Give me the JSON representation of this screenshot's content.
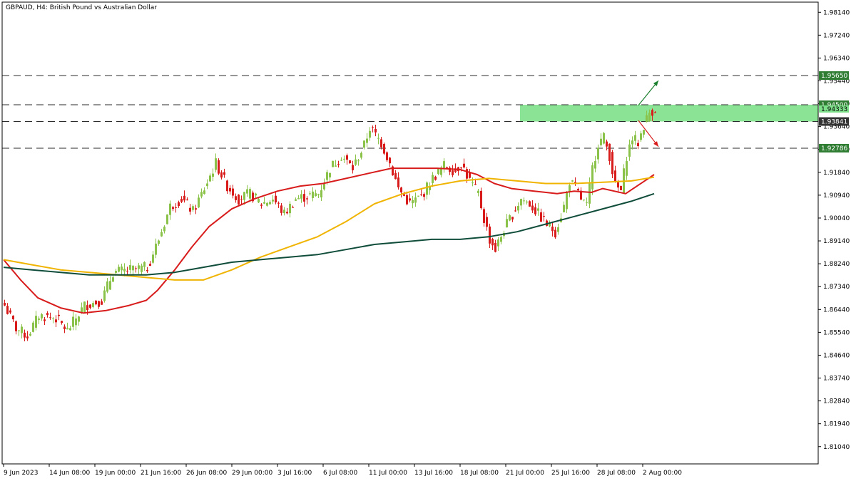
{
  "chart_data": {
    "type": "candlestick",
    "title": "GBPAUD, H4:  British Pound vs Australian Dollar",
    "symbol": "GBPAUD",
    "timeframe": "H4",
    "ylim": [
      1.8036,
      1.9854
    ],
    "y_ticks": [
      "1.98140",
      "1.97240",
      "1.96340",
      "1.95440",
      "1.94540",
      "1.93640",
      "1.92740",
      "1.91840",
      "1.90940",
      "1.90040",
      "1.89140",
      "1.88240",
      "1.87340",
      "1.86440",
      "1.85540",
      "1.84640",
      "1.83740",
      "1.82840",
      "1.81940",
      "1.81040"
    ],
    "x_ticks": [
      "9 Jun 2023",
      "14 Jun 08:00",
      "19 Jun 00:00",
      "21 Jun 16:00",
      "26 Jun 08:00",
      "29 Jun 00:00",
      "3 Jul 16:00",
      "6 Jul 08:00",
      "11 Jul 00:00",
      "13 Jul 16:00",
      "18 Jul 08:00",
      "21 Jul 00:00",
      "25 Jul 16:00",
      "28 Jul 08:00",
      "2 Aug 00:00"
    ],
    "x_tick_bar_index": [
      0,
      16,
      32,
      48,
      64,
      80,
      96,
      112,
      128,
      144,
      160,
      176,
      192,
      208,
      224
    ],
    "bar_count": 229,
    "levels": [
      {
        "value": 1.9565,
        "label": "1.95650",
        "color": "#2e7d32"
      },
      {
        "value": 1.945,
        "label": "1.94500",
        "color": "#2e7d32"
      },
      {
        "value": 1.9384,
        "label": "1.93841",
        "color": "#333333"
      },
      {
        "value": 1.9279,
        "label": "1.92786",
        "color": "#2e7d32"
      }
    ],
    "current_price_label": "1.94333",
    "zone": {
      "from_bar": 181,
      "top": 1.945,
      "bottom": 1.9384,
      "color": "#7ee08a"
    },
    "close_anchors": [
      [
        0,
        1.866
      ],
      [
        4,
        1.857
      ],
      [
        8,
        1.854
      ],
      [
        12,
        1.862
      ],
      [
        18,
        1.861
      ],
      [
        22,
        1.856
      ],
      [
        28,
        1.866
      ],
      [
        34,
        1.868
      ],
      [
        38,
        1.879
      ],
      [
        44,
        1.88
      ],
      [
        50,
        1.881
      ],
      [
        54,
        1.892
      ],
      [
        58,
        1.905
      ],
      [
        62,
        1.908
      ],
      [
        66,
        1.903
      ],
      [
        70,
        1.912
      ],
      [
        74,
        1.922
      ],
      [
        78,
        1.913
      ],
      [
        82,
        1.908
      ],
      [
        86,
        1.91
      ],
      [
        90,
        1.906
      ],
      [
        94,
        1.908
      ],
      [
        98,
        1.902
      ],
      [
        102,
        1.908
      ],
      [
        106,
        1.909
      ],
      [
        110,
        1.91
      ],
      [
        114,
        1.92
      ],
      [
        118,
        1.925
      ],
      [
        122,
        1.92
      ],
      [
        126,
        1.929
      ],
      [
        128,
        1.936
      ],
      [
        132,
        1.93
      ],
      [
        135,
        1.922
      ],
      [
        138,
        1.912
      ],
      [
        142,
        1.906
      ],
      [
        146,
        1.909
      ],
      [
        150,
        1.916
      ],
      [
        154,
        1.921
      ],
      [
        158,
        1.919
      ],
      [
        160,
        1.922
      ],
      [
        163,
        1.915
      ],
      [
        166,
        1.91
      ],
      [
        168,
        1.9
      ],
      [
        170,
        1.892
      ],
      [
        172,
        1.888
      ],
      [
        175,
        1.896
      ],
      [
        178,
        1.902
      ],
      [
        181,
        1.908
      ],
      [
        184,
        1.906
      ],
      [
        187,
        1.902
      ],
      [
        190,
        1.898
      ],
      [
        193,
        1.895
      ],
      [
        196,
        1.905
      ],
      [
        198,
        1.915
      ],
      [
        200,
        1.912
      ],
      [
        202,
        1.908
      ],
      [
        204,
        1.905
      ],
      [
        206,
        1.92
      ],
      [
        208,
        1.93
      ],
      [
        210,
        1.932
      ],
      [
        212,
        1.925
      ],
      [
        214,
        1.913
      ],
      [
        216,
        1.911
      ],
      [
        218,
        1.925
      ],
      [
        220,
        1.932
      ],
      [
        222,
        1.93
      ],
      [
        224,
        1.937
      ],
      [
        226,
        1.942
      ],
      [
        228,
        1.9433
      ]
    ],
    "series": [
      {
        "name": "",
        "color": "#d81b1b",
        "width": 2,
        "points": [
          [
            0,
            1.884
          ],
          [
            6,
            1.876
          ],
          [
            12,
            1.869
          ],
          [
            20,
            1.865
          ],
          [
            28,
            1.863
          ],
          [
            36,
            1.864
          ],
          [
            44,
            1.866
          ],
          [
            50,
            1.868
          ],
          [
            54,
            1.872
          ],
          [
            60,
            1.88
          ],
          [
            66,
            1.889
          ],
          [
            72,
            1.897
          ],
          [
            80,
            1.904
          ],
          [
            88,
            1.908
          ],
          [
            96,
            1.911
          ],
          [
            104,
            1.913
          ],
          [
            112,
            1.914
          ],
          [
            120,
            1.916
          ],
          [
            128,
            1.918
          ],
          [
            136,
            1.92
          ],
          [
            144,
            1.92
          ],
          [
            152,
            1.92
          ],
          [
            160,
            1.9195
          ],
          [
            166,
            1.9175
          ],
          [
            172,
            1.914
          ],
          [
            178,
            1.912
          ],
          [
            186,
            1.911
          ],
          [
            194,
            1.91
          ],
          [
            200,
            1.911
          ],
          [
            206,
            1.9105
          ],
          [
            210,
            1.912
          ],
          [
            214,
            1.911
          ],
          [
            218,
            1.91
          ],
          [
            222,
            1.913
          ],
          [
            226,
            1.916
          ],
          [
            228,
            1.9175
          ]
        ]
      },
      {
        "name": "",
        "color": "#f0b400",
        "width": 2,
        "points": [
          [
            0,
            1.884
          ],
          [
            10,
            1.882
          ],
          [
            20,
            1.88
          ],
          [
            30,
            1.879
          ],
          [
            40,
            1.878
          ],
          [
            50,
            1.877
          ],
          [
            60,
            1.876
          ],
          [
            70,
            1.876
          ],
          [
            80,
            1.88
          ],
          [
            90,
            1.885
          ],
          [
            100,
            1.889
          ],
          [
            110,
            1.893
          ],
          [
            120,
            1.899
          ],
          [
            130,
            1.906
          ],
          [
            140,
            1.91
          ],
          [
            150,
            1.913
          ],
          [
            160,
            1.915
          ],
          [
            170,
            1.916
          ],
          [
            180,
            1.915
          ],
          [
            190,
            1.914
          ],
          [
            200,
            1.914
          ],
          [
            210,
            1.9145
          ],
          [
            220,
            1.915
          ],
          [
            228,
            1.9165
          ]
        ]
      },
      {
        "name": "",
        "color": "#0f4d3a",
        "width": 2,
        "points": [
          [
            0,
            1.881
          ],
          [
            10,
            1.88
          ],
          [
            20,
            1.879
          ],
          [
            30,
            1.878
          ],
          [
            40,
            1.878
          ],
          [
            50,
            1.878
          ],
          [
            60,
            1.879
          ],
          [
            70,
            1.881
          ],
          [
            80,
            1.883
          ],
          [
            90,
            1.884
          ],
          [
            100,
            1.885
          ],
          [
            110,
            1.886
          ],
          [
            120,
            1.888
          ],
          [
            130,
            1.89
          ],
          [
            140,
            1.891
          ],
          [
            150,
            1.892
          ],
          [
            160,
            1.892
          ],
          [
            170,
            1.893
          ],
          [
            180,
            1.895
          ],
          [
            190,
            1.898
          ],
          [
            200,
            1.901
          ],
          [
            210,
            1.904
          ],
          [
            220,
            1.907
          ],
          [
            228,
            1.91
          ]
        ]
      }
    ],
    "arrows": [
      {
        "name": "bullish-arrow",
        "from": [
          222.5,
          1.9448
        ],
        "to": [
          229.5,
          1.9545
        ],
        "color": "#1a7f2e"
      },
      {
        "name": "bearish-arrow",
        "from": [
          222.5,
          1.9388
        ],
        "to": [
          229.5,
          1.9285
        ],
        "color": "#d81b1b"
      }
    ],
    "colors": {
      "up": "#8bc34a",
      "down": "#d81b1b",
      "grid": "#d0d0d0",
      "axis": "#000000"
    }
  }
}
